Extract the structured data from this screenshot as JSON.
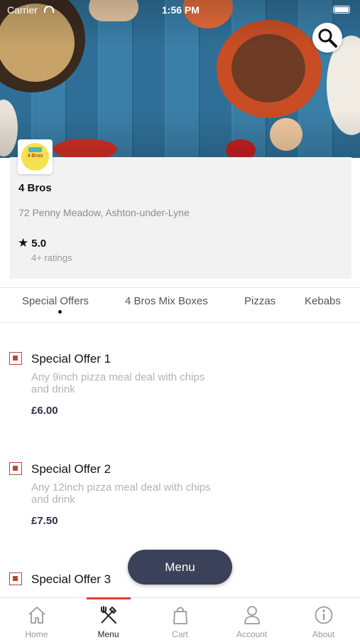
{
  "status_bar": {
    "carrier": "Carrier",
    "time": "1:56 PM"
  },
  "hero": {
    "search_icon": "search-icon"
  },
  "restaurant": {
    "logo_text": "4 Bros",
    "name": "4 Bros",
    "address": "72 Penny Meadow, Ashton-under-Lyne",
    "rating": "5.0",
    "ratings_count": "4+ ratings"
  },
  "tabs": [
    "Special Offers",
    "4 Bros Mix Boxes",
    "Pizzas",
    "Kebabs"
  ],
  "active_tab": "Special Offers",
  "items": [
    {
      "name": "Special Offer 1",
      "desc_line1": "Any 9inch pizza meal deal with chips",
      "desc_line2": "and drink",
      "price": "£6.00"
    },
    {
      "name": "Special Offer 2",
      "desc_line1": "Any 12inch pizza meal deal with chips",
      "desc_line2": "and drink",
      "price": "£7.50"
    },
    {
      "name": "Special Offer 3"
    }
  ],
  "floating_button": {
    "label": "Menu"
  },
  "bottom_nav": {
    "active": "Menu",
    "items": [
      {
        "label": "Home",
        "icon": "home-icon"
      },
      {
        "label": "Menu",
        "icon": "fork-knife-icon"
      },
      {
        "label": "Cart",
        "icon": "bag-icon"
      },
      {
        "label": "Account",
        "icon": "person-icon"
      },
      {
        "label": "About",
        "icon": "info-icon"
      }
    ]
  },
  "colors": {
    "accent": "#e53935",
    "item_checkbox": "#b9472f",
    "price": "#2b3046",
    "floating_button": "#3b4158"
  }
}
